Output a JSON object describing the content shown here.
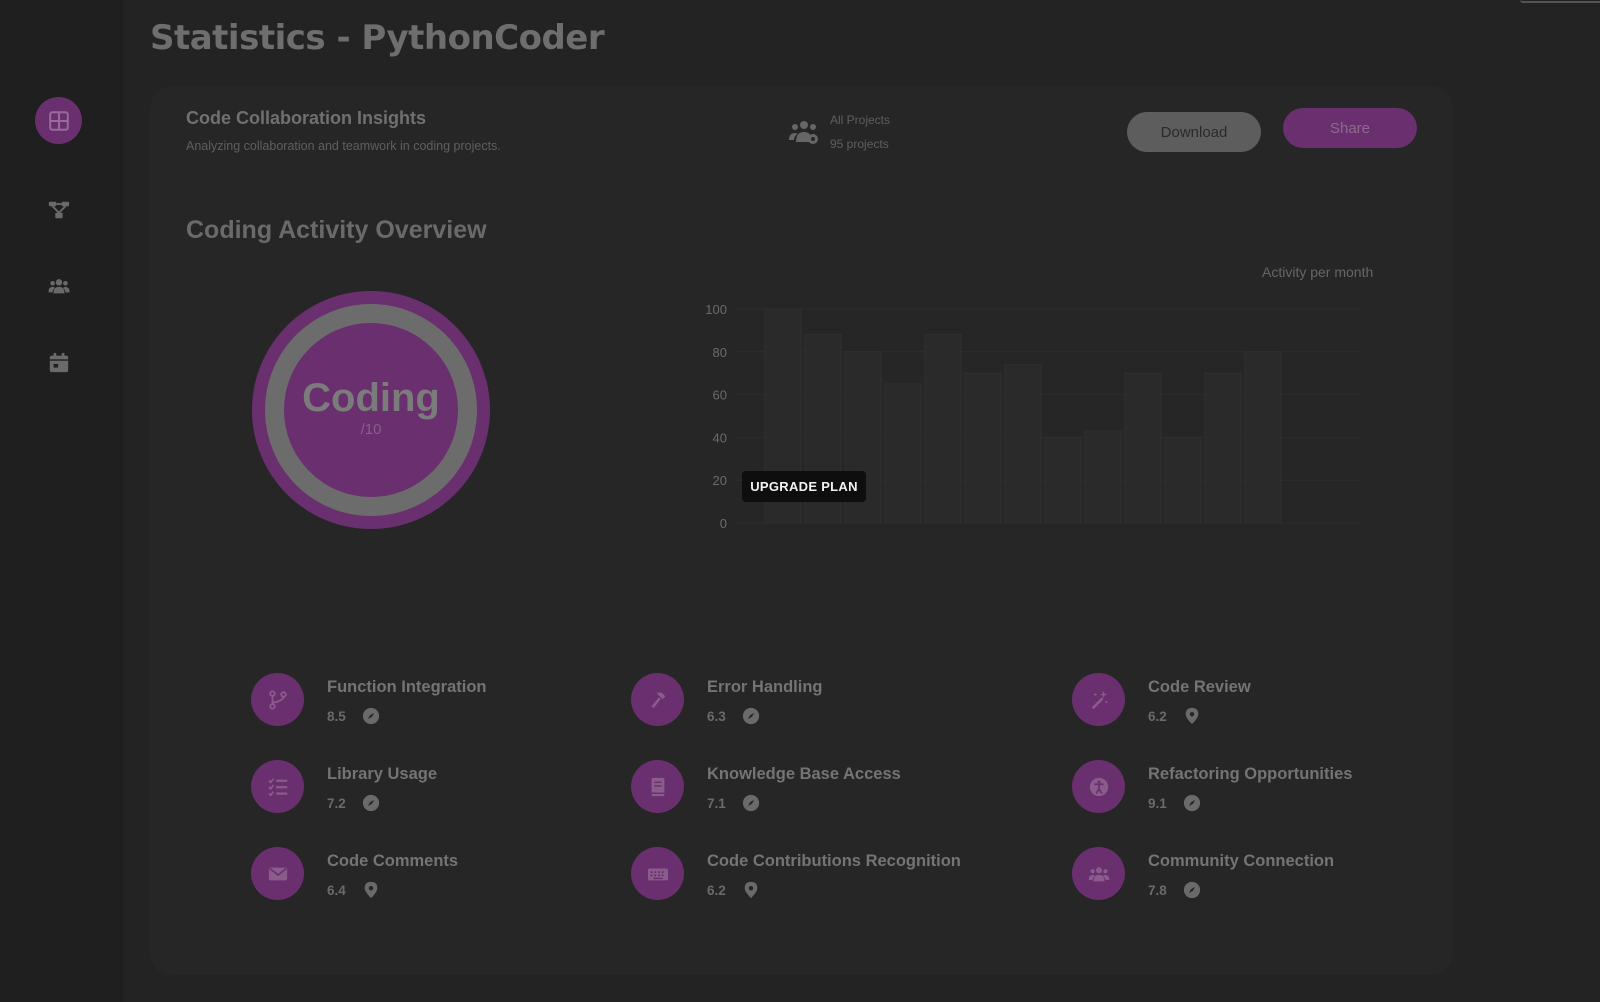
{
  "page": {
    "title": "Statistics - PythonCoder"
  },
  "sidebar": {
    "items": [
      {
        "name": "dashboard",
        "icon": "grid-icon",
        "active": true
      },
      {
        "name": "network",
        "icon": "hierarchy-icon",
        "active": false
      },
      {
        "name": "team",
        "icon": "users-icon",
        "active": false
      },
      {
        "name": "calendar",
        "icon": "calendar-icon",
        "active": false
      }
    ]
  },
  "card": {
    "title": "Code Collaboration Insights",
    "subtitle": "Analyzing collaboration and teamwork in coding projects.",
    "projects": {
      "label": "All Projects",
      "count": "95 projects",
      "icon": "users-gear-icon"
    },
    "download_label": "Download",
    "share_label": "Share"
  },
  "overview": {
    "title": "Coding Activity Overview",
    "score": {
      "label": "Coding",
      "suffix": "/10"
    },
    "chart_caption": "Activity per month",
    "upgrade_label": "UPGRADE PLAN"
  },
  "chart_data": {
    "type": "bar",
    "title": "Activity per month",
    "y_ticks": [
      "100",
      "80",
      "60",
      "40",
      "20",
      "0"
    ],
    "ylim": [
      0,
      100
    ],
    "values": [
      100,
      88,
      80,
      65,
      88,
      70,
      74,
      40,
      43,
      70,
      40,
      70,
      80
    ],
    "grid": true
  },
  "metrics": [
    {
      "name": "Function Integration",
      "value": "8.5",
      "icon": "git-branch-icon",
      "badge": "compass-icon"
    },
    {
      "name": "Error Handling",
      "value": "6.3",
      "icon": "hammer-icon",
      "badge": "compass-icon"
    },
    {
      "name": "Code Review",
      "value": "6.2",
      "icon": "magic-wand-icon",
      "badge": "location-pin-icon"
    },
    {
      "name": "Library Usage",
      "value": "7.2",
      "icon": "checklist-icon",
      "badge": "compass-icon"
    },
    {
      "name": "Knowledge Base Access",
      "value": "7.1",
      "icon": "book-icon",
      "badge": "compass-icon"
    },
    {
      "name": "Refactoring Opportunities",
      "value": "9.1",
      "icon": "accessibility-icon",
      "badge": "compass-icon"
    },
    {
      "name": "Code Comments",
      "value": "6.4",
      "icon": "envelope-icon",
      "badge": "location-pin-icon"
    },
    {
      "name": "Code Contributions Recognition",
      "value": "6.2",
      "icon": "keyboard-icon",
      "badge": "location-pin-icon"
    },
    {
      "name": "Community Connection",
      "value": "7.8",
      "icon": "users-icon",
      "badge": "compass-icon"
    }
  ],
  "colors": {
    "accent": "#6a2f6e",
    "background": "#232323",
    "card": "#262626"
  }
}
